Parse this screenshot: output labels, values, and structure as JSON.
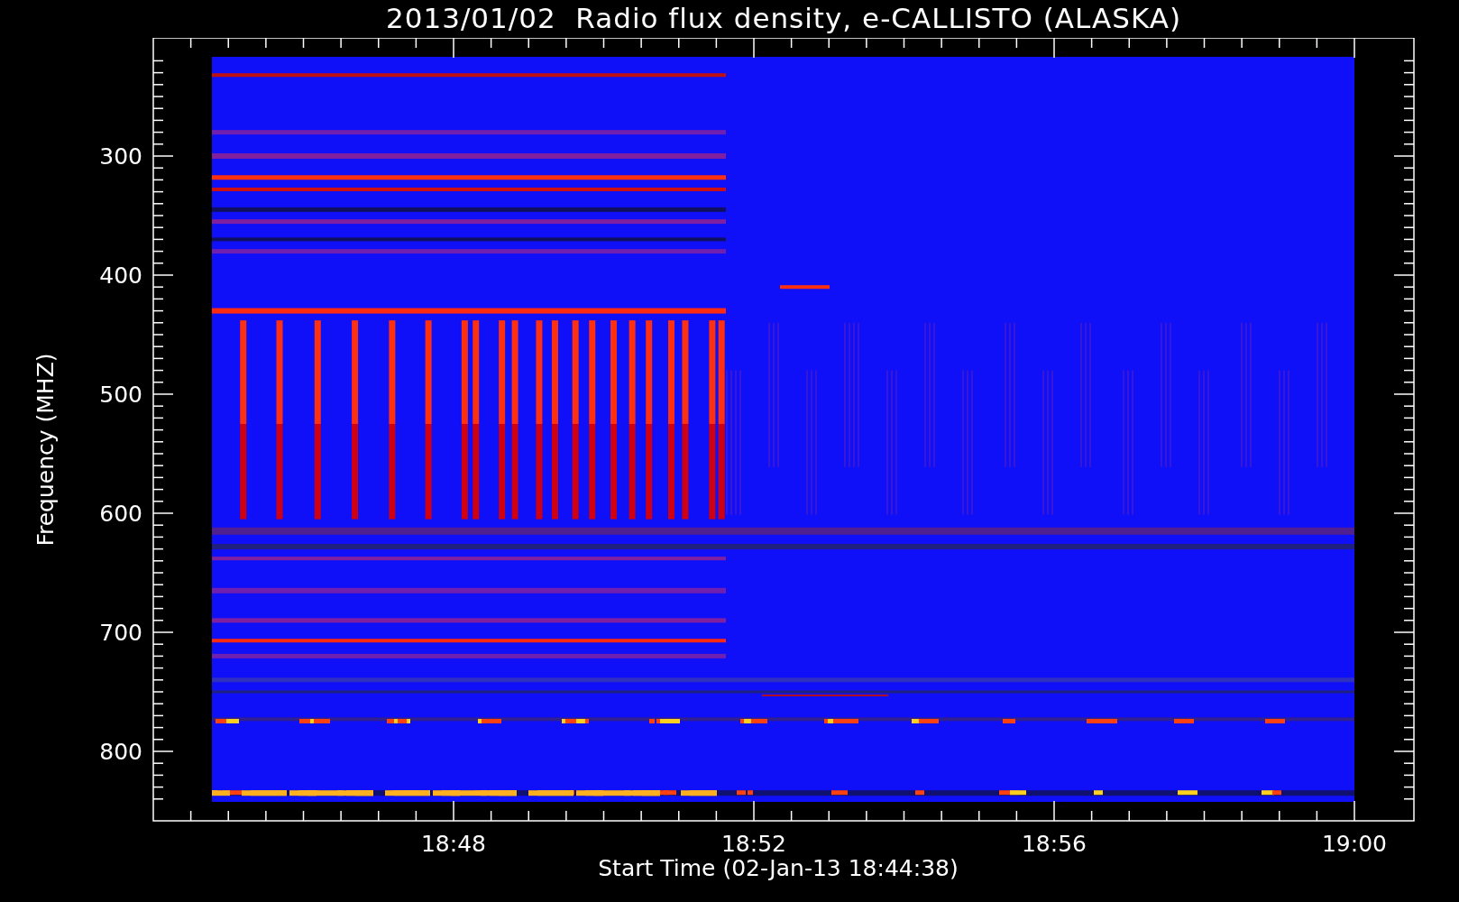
{
  "title": "2013/01/02  Radio flux density, e-CALLISTO (ALASKA)",
  "y_axis": {
    "title": "Frequency (MHZ)",
    "ticks": [
      "300",
      "400",
      "500",
      "600",
      "700",
      "800"
    ]
  },
  "x_axis": {
    "title": "Start Time (02-Jan-13 18:44:38)",
    "ticks": [
      "18:48",
      "18:52",
      "18:56",
      "19:00"
    ]
  }
}
